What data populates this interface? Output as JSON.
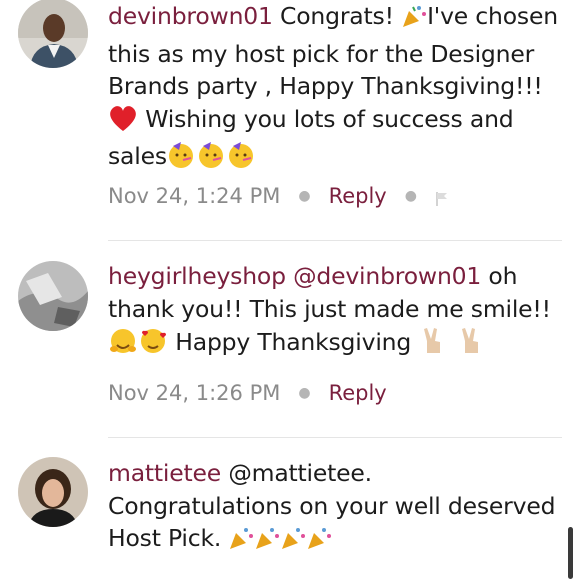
{
  "comments": [
    {
      "username": "devinbrown01",
      "text_1": "Congrats!",
      "text_2": "I've chosen this as my host pick for the Designer Brands party , Happy Thanksgiving!!!",
      "text_3": "Wishing you lots of success and sales",
      "timestamp": "Nov 24, 1:24 PM",
      "reply": "Reply"
    },
    {
      "username": "heygirlheyshop",
      "mention": "@devinbrown01",
      "text_1": "oh thank you!! This just made me smile!!",
      "text_2": "Happy Thanksgiving",
      "timestamp": "Nov 24, 1:26 PM",
      "reply": "Reply"
    },
    {
      "username": "mattietee",
      "mention": "@mattietee.",
      "text_1": "Congratulations on your well deserved Host Pick."
    }
  ],
  "colors": {
    "username": "#7a1f3d",
    "meta": "#8a8a8a",
    "divider": "#e5e5e5"
  },
  "icons": [
    "party-popper-icon",
    "red-heart-icon",
    "partying-face-icon",
    "hugging-face-icon",
    "smiling-hearts-icon",
    "victory-hand-icon",
    "flag-icon"
  ]
}
